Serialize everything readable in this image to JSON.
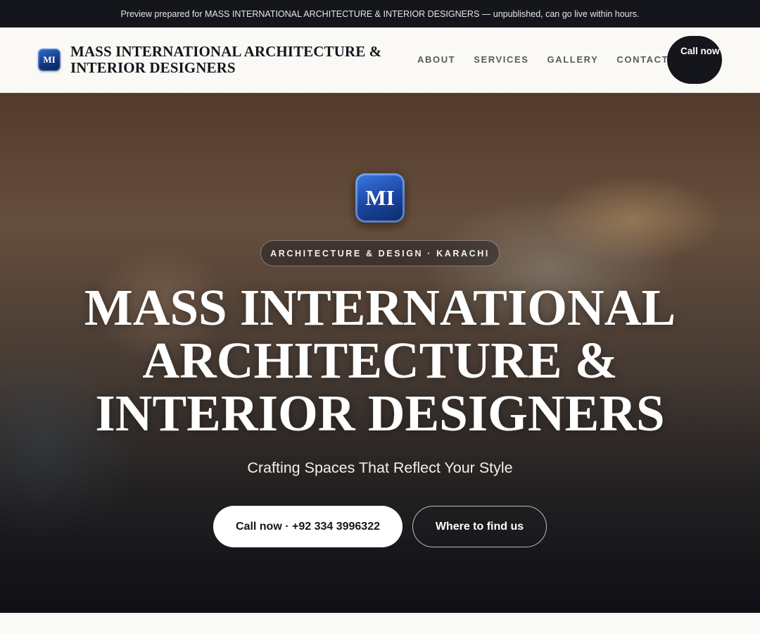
{
  "preview_banner": "Preview prepared for MASS INTERNATIONAL ARCHITECTURE & INTERIOR DESIGNERS — unpublished, can go live within hours.",
  "header": {
    "logo_initials": "MI",
    "brand_name": "MASS INTERNATIONAL ARCHITECTURE & INTERIOR DESIGNERS",
    "nav": [
      "ABOUT",
      "SERVICES",
      "GALLERY",
      "CONTACT"
    ],
    "call_button": "Call now"
  },
  "hero": {
    "logo_initials": "MI",
    "eyebrow": "ARCHITECTURE & DESIGN · KARACHI",
    "title": "MASS INTERNATIONAL ARCHITECTURE & INTERIOR DESIGNERS",
    "tagline": "Crafting Spaces That Reflect Your Style",
    "primary_cta": "Call now · +92 334 3996322",
    "secondary_cta": "Where to find us"
  },
  "colors": {
    "dark": "#14161b",
    "logo_blue": "#1a44a0",
    "page_bg": "#faf9f6"
  }
}
